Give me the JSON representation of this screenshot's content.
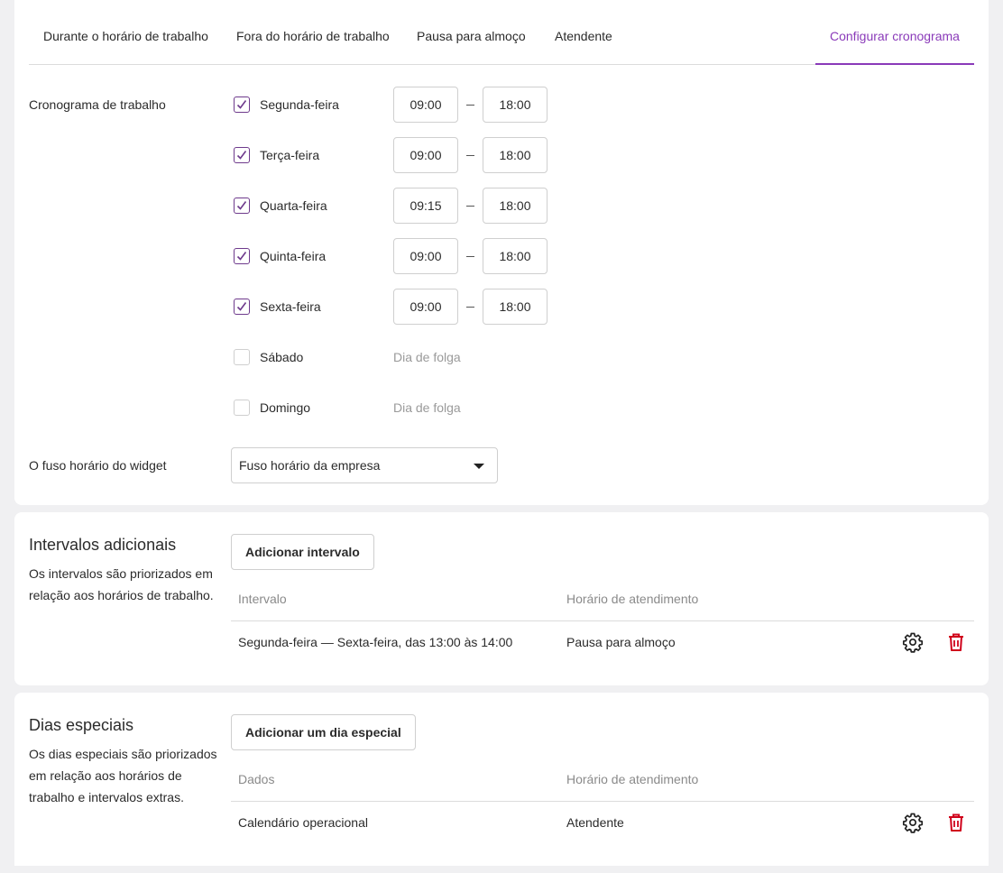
{
  "tabs": [
    {
      "label": "Durante o horário de trabalho",
      "active": false
    },
    {
      "label": "Fora do horário de trabalho",
      "active": false
    },
    {
      "label": "Pausa para almoço",
      "active": false
    },
    {
      "label": "Atendente",
      "active": false
    },
    {
      "label": "Configurar cronograma",
      "active": true
    }
  ],
  "schedule": {
    "label": "Cronograma de trabalho",
    "separator": "–",
    "days": [
      {
        "name": "Segunda-feira",
        "checked": true,
        "start": "09:00",
        "end": "18:00"
      },
      {
        "name": "Terça-feira",
        "checked": true,
        "start": "09:00",
        "end": "18:00"
      },
      {
        "name": "Quarta-feira",
        "checked": true,
        "start": "09:15",
        "end": "18:00"
      },
      {
        "name": "Quinta-feira",
        "checked": true,
        "start": "09:00",
        "end": "18:00"
      },
      {
        "name": "Sexta-feira",
        "checked": true,
        "start": "09:00",
        "end": "18:00"
      },
      {
        "name": "Sábado",
        "checked": false,
        "off_text": "Dia de folga"
      },
      {
        "name": "Domingo",
        "checked": false,
        "off_text": "Dia de folga"
      }
    ]
  },
  "timezone": {
    "label": "O fuso horário do widget",
    "selected": "Fuso horário da empresa"
  },
  "intervals": {
    "title": "Intervalos adicionais",
    "description": "Os intervalos são priorizados em relação aos horários de trabalho.",
    "add_button": "Adicionar intervalo",
    "columns": [
      "Intervalo",
      "Horário de atendimento"
    ],
    "rows": [
      {
        "interval": "Segunda-feira — Sexta-feira, das 13:00 às 14:00",
        "service": "Pausa para almoço"
      }
    ]
  },
  "special_days": {
    "title": "Dias especiais",
    "description": "Os dias especiais são priorizados em relação aos horários de trabalho e intervalos extras.",
    "add_button": "Adicionar um dia especial",
    "columns": [
      "Dados",
      "Horário de atendimento"
    ],
    "rows": [
      {
        "data": "Calendário operacional",
        "service": "Atendente"
      }
    ]
  },
  "colors": {
    "accent": "#8a3ab9",
    "checkbox": "#6e3a8c",
    "delete": "#d0021b"
  },
  "icons": {
    "settings": "gear-icon",
    "delete": "trash-icon",
    "check": "check-icon",
    "dropdown": "caret-down-icon"
  }
}
